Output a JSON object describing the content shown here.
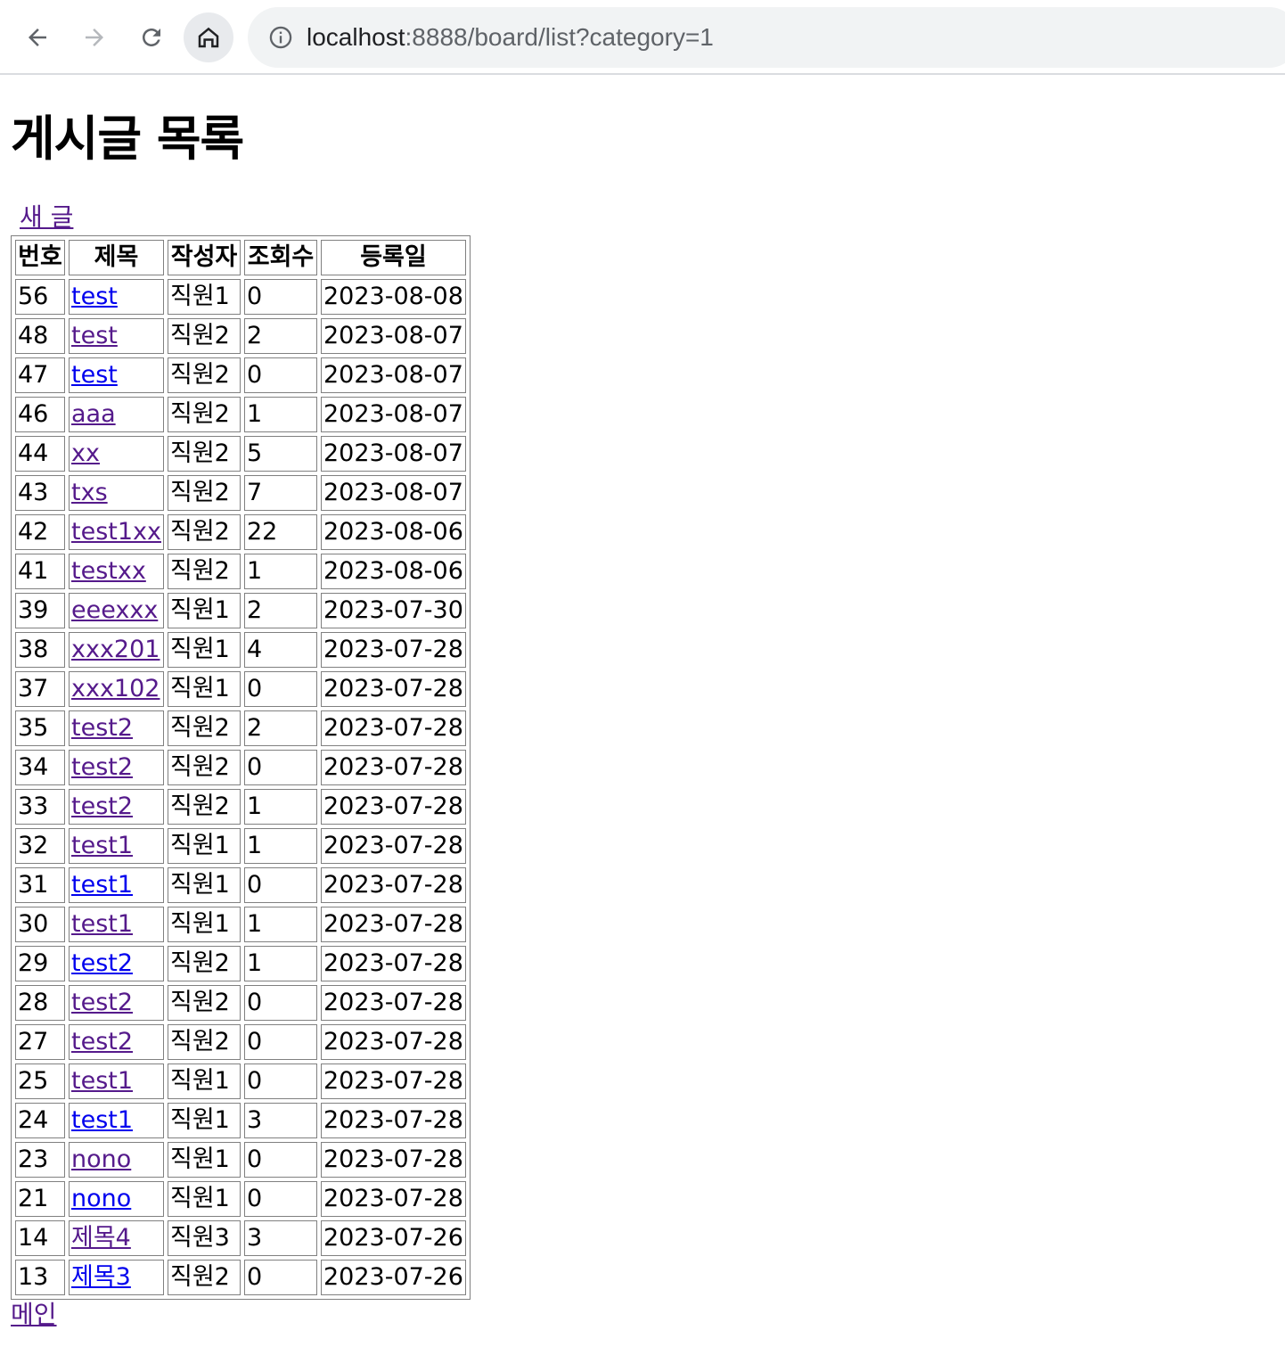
{
  "browser": {
    "url_host": "localhost",
    "url_rest": ":8888/board/list?category=1"
  },
  "page": {
    "title": "게시글 목록",
    "new_post_label": "새 글",
    "main_link_label": "메인"
  },
  "table": {
    "headers": [
      "번호",
      "제목",
      "작성자",
      "조회수",
      "등록일"
    ],
    "rows": [
      {
        "no": "56",
        "title": "test",
        "writer": "직원1",
        "views": "0",
        "date": "2023-08-08",
        "visited": false
      },
      {
        "no": "48",
        "title": "test",
        "writer": "직원2",
        "views": "2",
        "date": "2023-08-07",
        "visited": true
      },
      {
        "no": "47",
        "title": "test",
        "writer": "직원2",
        "views": "0",
        "date": "2023-08-07",
        "visited": false
      },
      {
        "no": "46",
        "title": "aaa",
        "writer": "직원2",
        "views": "1",
        "date": "2023-08-07",
        "visited": true
      },
      {
        "no": "44",
        "title": "xx",
        "writer": "직원2",
        "views": "5",
        "date": "2023-08-07",
        "visited": true
      },
      {
        "no": "43",
        "title": "txs",
        "writer": "직원2",
        "views": "7",
        "date": "2023-08-07",
        "visited": true
      },
      {
        "no": "42",
        "title": "test1xx",
        "writer": "직원2",
        "views": "22",
        "date": "2023-08-06",
        "visited": true
      },
      {
        "no": "41",
        "title": "testxx",
        "writer": "직원2",
        "views": "1",
        "date": "2023-08-06",
        "visited": true
      },
      {
        "no": "39",
        "title": "eeexxx",
        "writer": "직원1",
        "views": "2",
        "date": "2023-07-30",
        "visited": true
      },
      {
        "no": "38",
        "title": "xxx201",
        "writer": "직원1",
        "views": "4",
        "date": "2023-07-28",
        "visited": true
      },
      {
        "no": "37",
        "title": "xxx102",
        "writer": "직원1",
        "views": "0",
        "date": "2023-07-28",
        "visited": true
      },
      {
        "no": "35",
        "title": "test2",
        "writer": "직원2",
        "views": "2",
        "date": "2023-07-28",
        "visited": true
      },
      {
        "no": "34",
        "title": "test2",
        "writer": "직원2",
        "views": "0",
        "date": "2023-07-28",
        "visited": true
      },
      {
        "no": "33",
        "title": "test2",
        "writer": "직원2",
        "views": "1",
        "date": "2023-07-28",
        "visited": true
      },
      {
        "no": "32",
        "title": "test1",
        "writer": "직원1",
        "views": "1",
        "date": "2023-07-28",
        "visited": true
      },
      {
        "no": "31",
        "title": "test1",
        "writer": "직원1",
        "views": "0",
        "date": "2023-07-28",
        "visited": false
      },
      {
        "no": "30",
        "title": "test1",
        "writer": "직원1",
        "views": "1",
        "date": "2023-07-28",
        "visited": true
      },
      {
        "no": "29",
        "title": "test2",
        "writer": "직원2",
        "views": "1",
        "date": "2023-07-28",
        "visited": false
      },
      {
        "no": "28",
        "title": "test2",
        "writer": "직원2",
        "views": "0",
        "date": "2023-07-28",
        "visited": true
      },
      {
        "no": "27",
        "title": "test2",
        "writer": "직원2",
        "views": "0",
        "date": "2023-07-28",
        "visited": true
      },
      {
        "no": "25",
        "title": "test1",
        "writer": "직원1",
        "views": "0",
        "date": "2023-07-28",
        "visited": true
      },
      {
        "no": "24",
        "title": "test1",
        "writer": "직원1",
        "views": "3",
        "date": "2023-07-28",
        "visited": false
      },
      {
        "no": "23",
        "title": "nono",
        "writer": "직원1",
        "views": "0",
        "date": "2023-07-28",
        "visited": true
      },
      {
        "no": "21",
        "title": "nono",
        "writer": "직원1",
        "views": "0",
        "date": "2023-07-28",
        "visited": false
      },
      {
        "no": "14",
        "title": "제목4",
        "writer": "직원3",
        "views": "3",
        "date": "2023-07-26",
        "visited": true
      },
      {
        "no": "13",
        "title": "제목3",
        "writer": "직원2",
        "views": "0",
        "date": "2023-07-26",
        "visited": false
      }
    ]
  },
  "colors": {
    "link_visited": "#551a8b",
    "link_unvisited": "#0000ee",
    "table_border": "#808080",
    "omnibox_bg": "#f1f3f4"
  },
  "icons": {
    "back": "back-arrow-icon",
    "forward": "forward-arrow-icon",
    "reload": "reload-icon",
    "home": "home-icon",
    "site_info": "info-icon"
  }
}
